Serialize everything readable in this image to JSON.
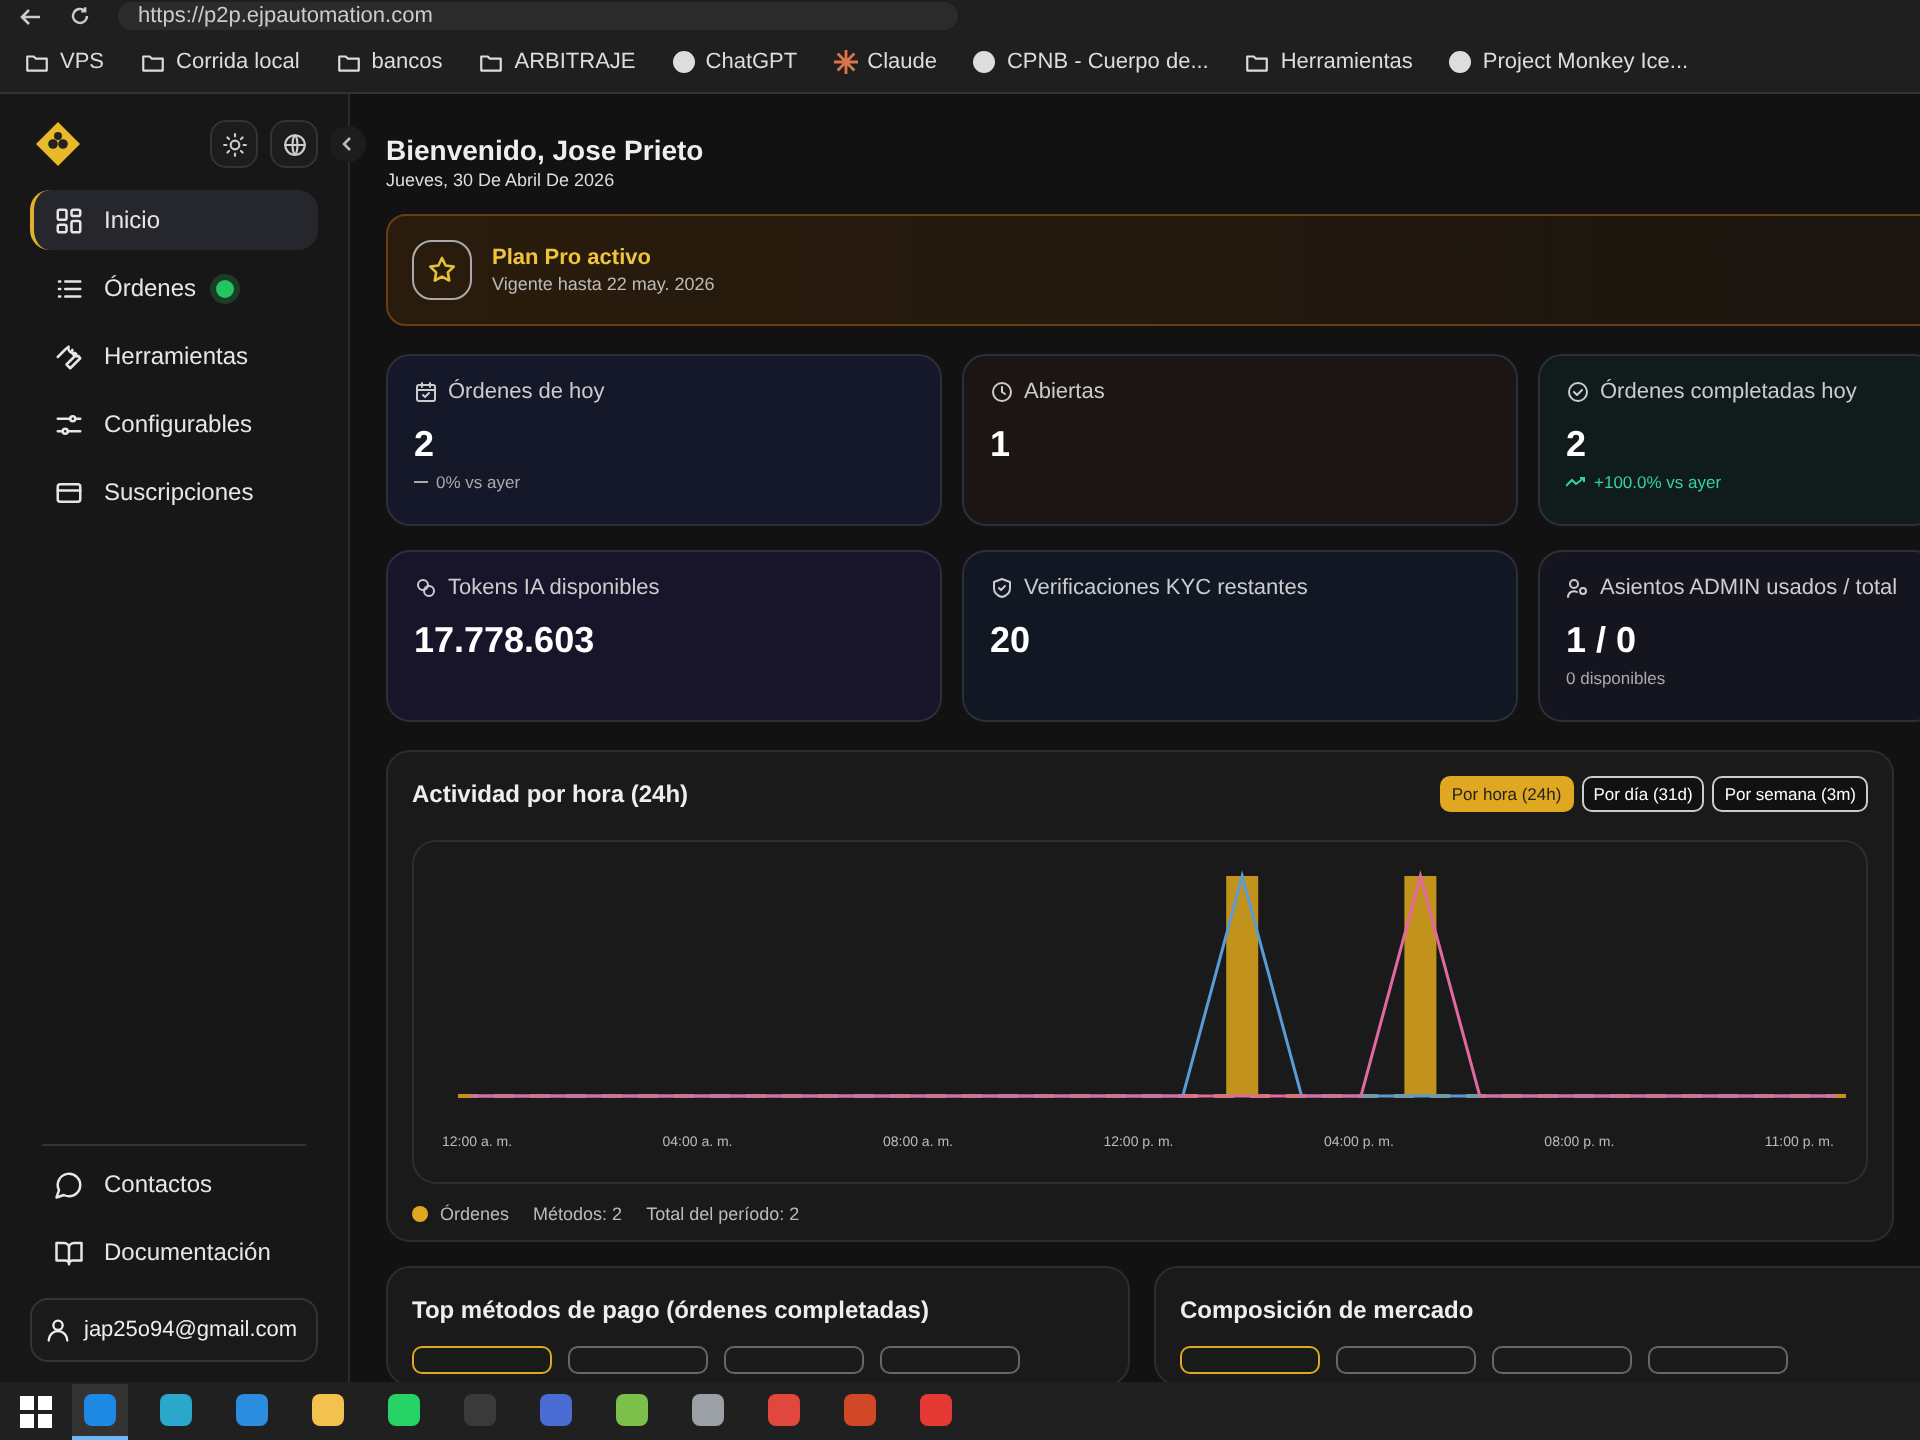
{
  "browser": {
    "url": "https://p2p.ejpautomation.com",
    "bookmarks": [
      {
        "kind": "folder",
        "label": "VPS"
      },
      {
        "kind": "folder",
        "label": "Corrida local"
      },
      {
        "kind": "folder",
        "label": "bancos"
      },
      {
        "kind": "folder",
        "label": "ARBITRAJE"
      },
      {
        "kind": "site",
        "label": "ChatGPT"
      },
      {
        "kind": "spark",
        "label": "Claude"
      },
      {
        "kind": "site",
        "label": "CPNB - Cuerpo de..."
      },
      {
        "kind": "folder",
        "label": "Herramientas"
      },
      {
        "kind": "site",
        "label": "Project Monkey Ice..."
      }
    ]
  },
  "sidebar": {
    "items": [
      {
        "kind": "grid",
        "label": "Inicio",
        "selected": true,
        "live": false
      },
      {
        "kind": "list",
        "label": "Órdenes",
        "selected": false,
        "live": true
      },
      {
        "kind": "wrench",
        "label": "Herramientas",
        "selected": false,
        "live": false
      },
      {
        "kind": "sliders",
        "label": "Configurables",
        "selected": false,
        "live": false
      },
      {
        "kind": "card",
        "label": "Suscripciones",
        "selected": false,
        "live": false
      }
    ],
    "footer_items": [
      {
        "kind": "chat",
        "label": "Contactos"
      },
      {
        "kind": "book",
        "label": "Documentación"
      }
    ],
    "user": "jap25o94@gmail.com"
  },
  "header": {
    "title": "Bienvenido, Jose Prieto",
    "date": "Jueves, 30 De Abril De 2026"
  },
  "plan": {
    "title": "Plan Pro activo",
    "subtitle": "Vigente hasta 22 may. 2026"
  },
  "stats": [
    {
      "kind": "calendar",
      "label": "Órdenes de hoy",
      "value": "2",
      "note": {
        "kind": "flat",
        "text": "0% vs ayer"
      },
      "color": "#141828"
    },
    {
      "kind": "clock",
      "label": "Abiertas",
      "value": "1",
      "color": "#1c1513"
    },
    {
      "kind": "check",
      "label": "Órdenes completadas hoy",
      "value": "2",
      "note": {
        "kind": "up",
        "text": "+100.0% vs ayer"
      },
      "color": "#101b1b"
    },
    {
      "kind": "link",
      "label": "Tokens IA disponibles",
      "value": "17.778.603",
      "color": "#18152a"
    },
    {
      "kind": "shield",
      "label": "Verificaciones KYC restantes",
      "value": "20",
      "color": "#111824"
    },
    {
      "kind": "users",
      "label": "Asientos ADMIN usados / total",
      "value": "1 / 0",
      "note": {
        "kind": "plain",
        "text": "0 disponibles"
      },
      "color": "#15151f"
    }
  ],
  "activity": {
    "title": "Actividad por hora (24h)",
    "ranges": [
      {
        "label": "Por hora (24h)",
        "selected": true
      },
      {
        "label": "Por día (31d)",
        "selected": false
      },
      {
        "label": "Por semana (3m)",
        "selected": false
      }
    ],
    "x_labels": [
      "12:00 a. m.",
      "04:00 a. m.",
      "08:00 a. m.",
      "12:00 p. m.",
      "04:00 p. m.",
      "08:00 p. m.",
      "11:00 p. m."
    ],
    "legend": {
      "series": "Órdenes",
      "methods": "Métodos: 2",
      "total": "Total del período: 2"
    }
  },
  "panels": [
    {
      "title": "Top métodos de pago (órdenes completadas)",
      "chips": [
        {
          "selected": true
        },
        {
          "selected": false
        },
        {
          "selected": false
        },
        {
          "selected": false
        }
      ]
    },
    {
      "title": "Composición de mercado",
      "chips": [
        {
          "selected": true
        },
        {
          "selected": false
        },
        {
          "selected": false
        },
        {
          "selected": false
        }
      ]
    }
  ],
  "taskbar": {
    "apps": [
      {
        "color": "#1e88e5",
        "selected": true
      },
      {
        "color": "#2aa7c9",
        "selected": false
      },
      {
        "color": "#2b8de0",
        "selected": false
      },
      {
        "color": "#f2c14e",
        "selected": false
      },
      {
        "color": "#25d366",
        "selected": false
      },
      {
        "color": "#3a3a3a",
        "selected": false
      },
      {
        "color": "#4a6cd4",
        "selected": false
      },
      {
        "color": "#7cc04b",
        "selected": false
      },
      {
        "color": "#9aa0a6",
        "selected": false
      },
      {
        "color": "#e0483e",
        "selected": false
      },
      {
        "color": "#d24726",
        "selected": false
      },
      {
        "color": "#e53935",
        "selected": false
      }
    ]
  }
}
